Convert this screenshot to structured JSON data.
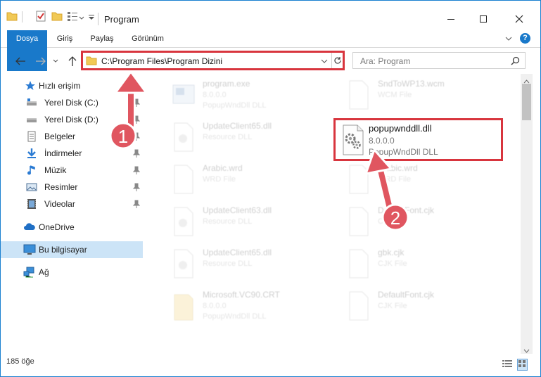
{
  "window": {
    "title": "Program",
    "controls": [
      "minimize",
      "maximize",
      "close"
    ]
  },
  "ribbon": {
    "tabs": [
      "Dosya",
      "Giriş",
      "Paylaş",
      "Görünüm"
    ],
    "help": "?"
  },
  "address": {
    "path": "C:\\Program Files\\Program Dizini",
    "search_placeholder": "Ara: Program"
  },
  "sidebar": {
    "quick_access": "Hızlı erişim",
    "items": [
      {
        "label": "Yerel Disk (C:)",
        "icon": "drive-icon",
        "pinned": true
      },
      {
        "label": "Yerel Disk (D:)",
        "icon": "drive-icon",
        "pinned": true
      },
      {
        "label": "Belgeler",
        "icon": "documents-icon",
        "pinned": true
      },
      {
        "label": "İndirmeler",
        "icon": "download-icon",
        "pinned": true
      },
      {
        "label": "Müzik",
        "icon": "music-icon",
        "pinned": true
      },
      {
        "label": "Resimler",
        "icon": "pictures-icon",
        "pinned": true
      },
      {
        "label": "Videolar",
        "icon": "videos-icon",
        "pinned": true
      }
    ],
    "onedrive": "OneDrive",
    "this_pc": "Bu bilgisayar",
    "network": "Ağ"
  },
  "files": [
    {
      "name": "program.exe",
      "line2": "8.0.0.0",
      "line3": "PopupWndDll DLL",
      "icon": "exe-icon"
    },
    {
      "name": "SndToWP13.wcm",
      "line2": "WCM File",
      "line3": "",
      "icon": "file-icon"
    },
    {
      "name": "UpdateClient65.dll",
      "line2": "Resource DLL",
      "line3": "",
      "icon": "dll-icon"
    },
    {
      "name": "popupwnddll.dll",
      "line2": "8.0.0.0",
      "line3": "PopupWndDll DLL",
      "icon": "dll-icon"
    },
    {
      "name": "Arabic.wrd",
      "line2": "WRD File",
      "line3": "",
      "icon": "file-icon"
    },
    {
      "name": "Arabic.wrd",
      "line2": "WRD File",
      "line3": "",
      "icon": "file-icon"
    },
    {
      "name": "UpdateClient63.dll",
      "line2": "Resource DLL",
      "line3": "",
      "icon": "dll-icon"
    },
    {
      "name": "DefaultFont.cjk",
      "line2": "CJK File",
      "line3": "",
      "icon": "file-icon"
    },
    {
      "name": "UpdateClient65.dll",
      "line2": "Resource DLL",
      "line3": "",
      "icon": "dll-icon"
    },
    {
      "name": "gbk.cjk",
      "line2": "CJK File",
      "line3": "",
      "icon": "file-icon"
    },
    {
      "name": "Microsoft.VC90.CRT",
      "line2": "8.0.0.0",
      "line3": "PopupWndDll DLL",
      "icon": "folder-icon"
    },
    {
      "name": "DefaultFont.cjk",
      "line2": "CJK File",
      "line3": "",
      "icon": "file-icon"
    }
  ],
  "highlighted_file": "popupwnddll.dll",
  "status": {
    "count": "185 öğe"
  },
  "annotations": {
    "step1": "1",
    "step2": "2",
    "color": "#e05660"
  }
}
